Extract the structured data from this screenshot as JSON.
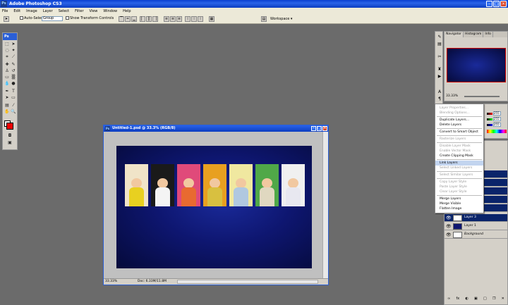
{
  "app": {
    "title": "Adobe Photoshop CS3",
    "icon": "Ps"
  },
  "menu": [
    "File",
    "Edit",
    "Image",
    "Layer",
    "Select",
    "Filter",
    "View",
    "Window",
    "Help"
  ],
  "options": {
    "auto_select_label": "Auto-Select:",
    "auto_select_value": "Group",
    "show_transform_label": "Show Transform Controls",
    "workspace_label": "Workspace ▾"
  },
  "toolbox": {
    "badge": "Ps"
  },
  "document": {
    "title": "Untitled-1.psd @ 33.3% (RGB/8)",
    "zoom": "33.33%",
    "doc_info": "Doc: 6.33M/11.8M",
    "photos": [
      {
        "bg": "#f0e4c8",
        "shirt": "#e8d020"
      },
      {
        "bg": "#1a1a1a",
        "shirt": "#f4f4f4"
      },
      {
        "bg": "#e04a7a",
        "shirt": "#e86a30"
      },
      {
        "bg": "#e8a020",
        "shirt": "#d8c040"
      },
      {
        "bg": "#f0e8a0",
        "shirt": "#b0c8e0"
      },
      {
        "bg": "#50a848",
        "shirt": "#e0d8c0"
      },
      {
        "bg": "#f0f0f0",
        "shirt": "#e8e8f0"
      }
    ]
  },
  "navigator": {
    "tabs": [
      "Navigator",
      "Histogram",
      "Info"
    ],
    "zoom": "33.33%"
  },
  "color_panel": {
    "r": "255",
    "g": "255",
    "b": "255"
  },
  "context_menu": [
    {
      "label": "Layer Properties...",
      "disabled": true
    },
    {
      "label": "Blending Options...",
      "disabled": true
    },
    {
      "sep": true
    },
    {
      "label": "Duplicate Layers...",
      "disabled": false
    },
    {
      "label": "Delete Layers",
      "disabled": false
    },
    {
      "sep": true
    },
    {
      "label": "Convert to Smart Object",
      "disabled": false
    },
    {
      "sep": true
    },
    {
      "label": "Rasterize Layers",
      "disabled": true
    },
    {
      "sep": true
    },
    {
      "label": "Disable Layer Mask",
      "disabled": true
    },
    {
      "label": "Enable Vector Mask",
      "disabled": true
    },
    {
      "label": "Create Clipping Mask",
      "disabled": false
    },
    {
      "sep": true
    },
    {
      "label": "Link Layers",
      "disabled": false,
      "highlighted": true
    },
    {
      "label": "Select Linked Layers",
      "disabled": true
    },
    {
      "sep": true
    },
    {
      "label": "Select Similar Layers",
      "disabled": true
    },
    {
      "sep": true
    },
    {
      "label": "Copy Layer Style",
      "disabled": true
    },
    {
      "label": "Paste Layer Style",
      "disabled": true
    },
    {
      "label": "Clear Layer Style",
      "disabled": true
    },
    {
      "sep": true
    },
    {
      "label": "Merge Layers",
      "disabled": false
    },
    {
      "label": "Merge Visible",
      "disabled": false
    },
    {
      "label": "Flatten Image",
      "disabled": false
    }
  ],
  "layers": [
    {
      "name": "",
      "selected": true,
      "thumb": "#c8c8d8"
    },
    {
      "name": "",
      "selected": true,
      "thumb": "#c8c8d8"
    },
    {
      "name": "",
      "selected": true,
      "thumb": "#c8c8d8"
    },
    {
      "name": "",
      "selected": true,
      "thumb": "#c8c8d8"
    },
    {
      "name": "",
      "selected": true,
      "thumb": "#c8c8d8"
    },
    {
      "name": "Layer 3",
      "selected": true,
      "thumb": "#ffffff"
    },
    {
      "name": "Layer 1",
      "selected": false,
      "thumb": "#0e1670"
    },
    {
      "name": "Background",
      "selected": false,
      "thumb": "#ffffff"
    }
  ],
  "layers_footer": [
    "∞",
    "fx",
    "◐",
    "▣",
    "□",
    "❐",
    "✕"
  ]
}
